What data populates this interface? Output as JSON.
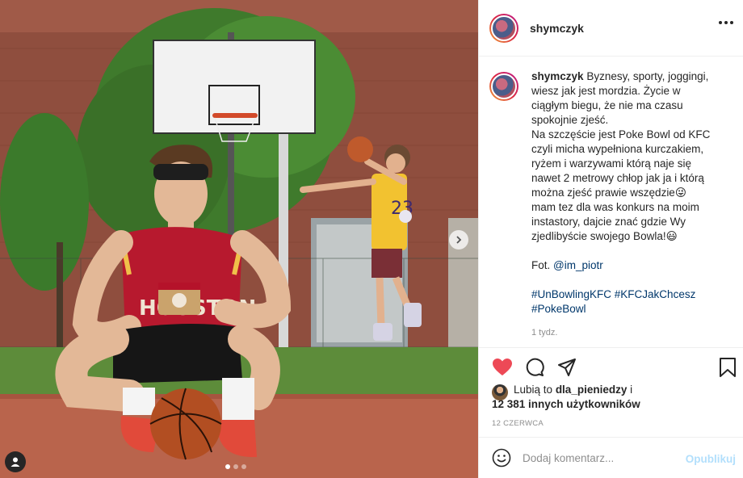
{
  "post": {
    "username": "shymczyk",
    "caption": {
      "username": "shymczyk",
      "lines": [
        "Byznesy, sporty, joggingi,",
        "wiesz jak jest mordzia. Życie w",
        "ciągłym biegu, że nie ma czasu",
        "spokojnie zjeść.",
        "Na szczęście jest Poke Bowl od KFC",
        "czyli micha wypełniona kurczakiem,",
        "ryżem i warzywami którą naje się",
        "nawet 2 metrowy chłop jak ja i którą",
        "można zjeść prawie wszędzie😜",
        "mam tez dla was konkurs na moim",
        "instastory, dajcie znać gdzie Wy",
        "zjedlibyście swojego Bowla!😃"
      ],
      "photo_credit_prefix": "Fot.",
      "photo_credit_mention": "@im_piotr",
      "hashtags_line1": "#UnBowlingKFC #KFCJakChcesz",
      "hashtags_line2": "#PokeBowl"
    },
    "time_ago": "1 tydz.",
    "likes": {
      "prefix": "Lubią to",
      "first_user": "dla_pieniedzy",
      "connector": "i",
      "others": "12 381 innych użytkowników"
    },
    "date": "12 CZERWCA",
    "comment": {
      "placeholder": "Dodaj komentarz...",
      "publish_label": "Opublikuj"
    },
    "carousel": {
      "total": 3,
      "active_index": 0
    }
  },
  "colors": {
    "like_red": "#ed4956",
    "link_blue": "#00376b",
    "publish_disabled": "#b2dffc",
    "muted": "#8e8e8e"
  },
  "icons": [
    "more-options-icon",
    "heart-icon",
    "comment-icon",
    "share-icon",
    "bookmark-icon",
    "emoji-icon",
    "next-arrow-icon",
    "user-tag-icon"
  ]
}
